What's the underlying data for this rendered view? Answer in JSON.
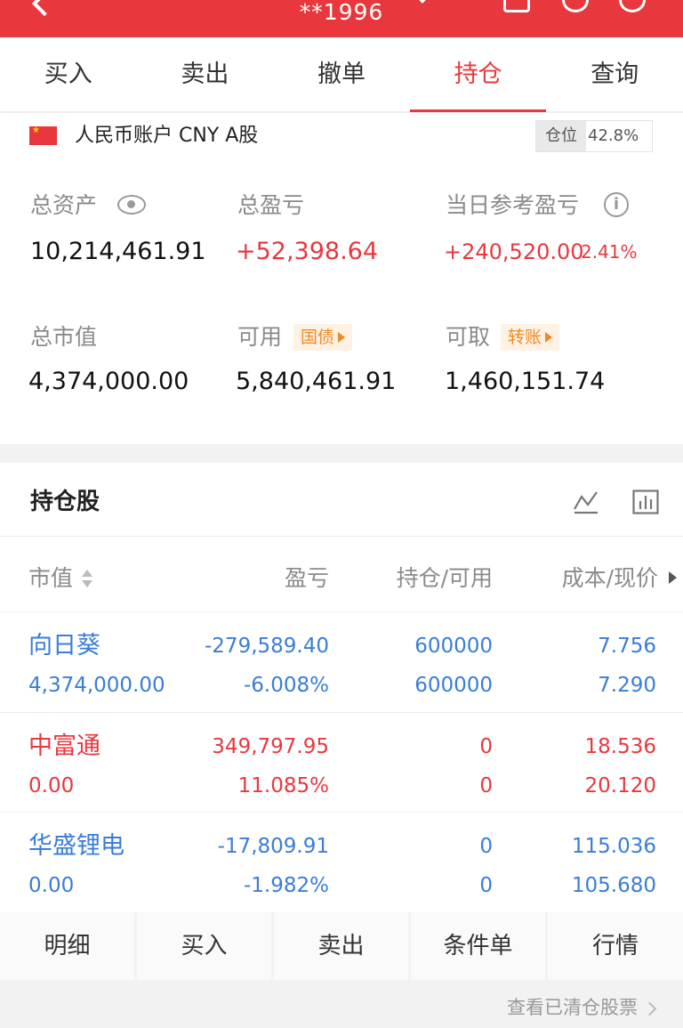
{
  "header": {
    "title": "**1996"
  },
  "tabs": [
    "买入",
    "卖出",
    "撤单",
    "持仓",
    "查询"
  ],
  "account": {
    "name": "人民币账户 CNY A股",
    "position_label": "仓位",
    "position_value": "42.8%"
  },
  "metrics": {
    "total_assets_label": "总资产",
    "total_assets": "10,214,461.91",
    "total_pnl_label": "总盈亏",
    "total_pnl": "+52,398.64",
    "daily_pnl_label": "当日参考盈亏",
    "daily_pnl": "+240,520.00",
    "daily_pnl_pct": "2.41%",
    "market_value_label": "总市值",
    "market_value": "4,374,000.00",
    "available_label": "可用",
    "available_tag": "国债",
    "available": "5,840,461.91",
    "withdrawable_label": "可取",
    "withdrawable_tag": "转账",
    "withdrawable": "1,460,151.74"
  },
  "holdings": {
    "title": "持仓股",
    "columns": [
      "市值",
      "盈亏",
      "持仓/可用",
      "成本/现价"
    ],
    "rows": [
      {
        "name": "向日葵",
        "market_value": "4,374,000.00",
        "pnl": "-279,589.40",
        "pnl_pct": "-6.008%",
        "position": "600000",
        "available": "600000",
        "cost": "7.756",
        "price": "7.290",
        "color": "#3a7dd8"
      },
      {
        "name": "中富通",
        "market_value": "0.00",
        "pnl": "349,797.95",
        "pnl_pct": "11.085%",
        "position": "0",
        "available": "0",
        "cost": "18.536",
        "price": "20.120",
        "color": "#e8383d"
      },
      {
        "name": "华盛锂电",
        "market_value": "0.00",
        "pnl": "-17,809.91",
        "pnl_pct": "-1.982%",
        "position": "0",
        "available": "0",
        "cost": "115.036",
        "price": "105.680",
        "color": "#3a7dd8"
      }
    ]
  },
  "actions": [
    "明细",
    "买入",
    "卖出",
    "条件单",
    "行情"
  ],
  "footer_link": "查看已清仓股票"
}
